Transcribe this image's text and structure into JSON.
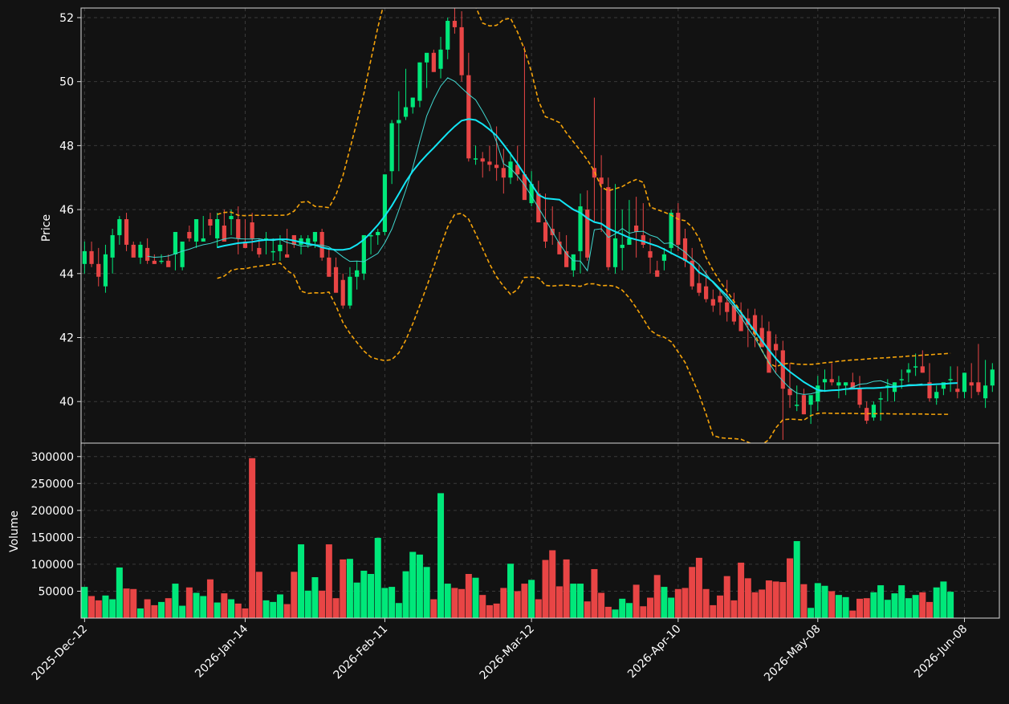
{
  "chart_data": {
    "type": "candlestick",
    "dates": [
      "2025-12-12",
      "2025-12-15",
      "2025-12-16",
      "2025-12-17",
      "2025-12-18",
      "2025-12-19",
      "2025-12-22",
      "2025-12-23",
      "2025-12-24",
      "2025-12-25",
      "2025-12-26",
      "2025-12-29",
      "2025-12-30",
      "2025-12-31",
      "2026-01-01",
      "2026-01-02",
      "2026-01-05",
      "2026-01-06",
      "2026-01-07",
      "2026-01-08",
      "2026-01-09",
      "2026-01-12",
      "2026-01-13",
      "2026-01-14",
      "2026-01-15",
      "2026-01-16",
      "2026-01-19",
      "2026-01-20",
      "2026-01-21",
      "2026-01-22",
      "2026-01-23",
      "2026-01-26",
      "2026-01-27",
      "2026-01-28",
      "2026-01-29",
      "2026-01-30",
      "2026-02-02",
      "2026-02-03",
      "2026-02-04",
      "2026-02-05",
      "2026-02-06",
      "2026-02-09",
      "2026-02-10",
      "2026-02-11",
      "2026-02-12",
      "2026-02-13",
      "2026-02-16",
      "2026-02-17",
      "2026-02-18",
      "2026-02-19",
      "2026-02-20",
      "2026-02-23",
      "2026-02-24",
      "2026-02-25",
      "2026-02-26",
      "2026-02-27",
      "2026-03-02",
      "2026-03-03",
      "2026-03-04",
      "2026-03-05",
      "2026-03-06",
      "2026-03-09",
      "2026-03-10",
      "2026-03-11",
      "2026-03-12",
      "2026-03-13",
      "2026-03-16",
      "2026-03-17",
      "2026-03-18",
      "2026-03-19",
      "2026-03-20",
      "2026-03-23",
      "2026-03-24",
      "2026-03-25",
      "2026-03-26",
      "2026-03-27",
      "2026-03-30",
      "2026-03-31",
      "2026-04-01",
      "2026-04-02",
      "2026-04-03",
      "2026-04-06",
      "2026-04-07",
      "2026-04-08",
      "2026-04-09",
      "2026-04-10",
      "2026-04-13",
      "2026-04-14",
      "2026-04-15",
      "2026-04-16",
      "2026-04-17",
      "2026-04-20",
      "2026-04-21",
      "2026-04-22",
      "2026-04-23",
      "2026-04-24",
      "2026-04-27",
      "2026-04-28",
      "2026-04-29",
      "2026-04-30",
      "2026-05-01",
      "2026-05-04",
      "2026-05-05",
      "2026-05-06",
      "2026-05-07",
      "2026-05-08",
      "2026-05-11",
      "2026-05-12",
      "2026-05-13",
      "2026-05-14",
      "2026-05-15",
      "2026-05-18",
      "2026-05-19",
      "2026-05-20",
      "2026-05-21",
      "2026-05-22",
      "2026-05-25",
      "2026-05-26",
      "2026-05-27",
      "2026-05-28",
      "2026-05-29",
      "2026-06-01",
      "2026-06-02",
      "2026-06-03",
      "2026-06-04",
      "2026-06-05",
      "2026-06-08",
      "2026-06-09",
      "2026-06-10",
      "2026-06-11",
      "2026-06-12"
    ],
    "open": [
      44.3,
      44.7,
      44.3,
      43.6,
      44.5,
      45.2,
      45.7,
      44.9,
      44.5,
      44.8,
      44.4,
      44.4,
      44.4,
      44.6,
      44.2,
      45.3,
      45.0,
      45.0,
      45.7,
      45.1,
      45.5,
      45.7,
      45.7,
      45.0,
      45.6,
      44.8,
      45.1,
      44.7,
      44.7,
      44.6,
      45.2,
      44.9,
      44.9,
      45.0,
      45.3,
      44.5,
      44.2,
      43.8,
      43.0,
      43.9,
      44.0,
      45.2,
      45.2,
      45.3,
      47.2,
      48.7,
      48.9,
      49.2,
      49.4,
      50.6,
      50.9,
      50.4,
      51.0,
      51.9,
      51.7,
      50.2,
      47.6,
      47.6,
      47.5,
      47.4,
      47.3,
      47.0,
      47.4,
      47.1,
      46.2,
      46.5,
      45.6,
      45.4,
      45.0,
      44.7,
      44.1,
      44.7,
      46.0,
      47.3,
      47.0,
      46.7,
      44.2,
      44.8,
      44.9,
      45.5,
      45.2,
      44.7,
      44.1,
      44.4,
      44.8,
      45.9,
      45.1,
      44.4,
      43.7,
      43.6,
      43.2,
      43.3,
      43.1,
      43.0,
      42.7,
      42.6,
      42.7,
      42.3,
      42.2,
      41.8,
      41.6,
      40.4,
      39.9,
      40.2,
      39.9,
      40.0,
      40.6,
      40.7,
      40.5,
      40.5,
      40.6,
      40.4,
      39.8,
      39.5,
      40.1,
      40.5,
      40.3,
      40.7,
      40.9,
      41.1,
      41.1,
      40.6,
      40.1,
      40.4,
      40.7,
      40.4,
      40.3,
      40.6,
      40.6,
      40.1,
      40.5
    ],
    "high": [
      45.0,
      45.0,
      44.8,
      44.9,
      45.4,
      45.8,
      45.9,
      45.0,
      45.0,
      45.1,
      44.6,
      44.6,
      44.6,
      44.9,
      44.9,
      45.5,
      45.7,
      45.8,
      45.9,
      45.9,
      46.0,
      46.0,
      46.1,
      45.7,
      45.9,
      45.1,
      45.3,
      45.1,
      45.2,
      45.4,
      45.2,
      45.2,
      45.2,
      45.3,
      45.4,
      44.8,
      44.5,
      44.0,
      44.2,
      44.4,
      44.7,
      45.3,
      45.4,
      45.6,
      48.8,
      49.7,
      50.4,
      49.5,
      50.6,
      50.7,
      51.0,
      51.4,
      52.0,
      52.3,
      52.2,
      50.9,
      48.0,
      47.8,
      48.0,
      48.6,
      47.9,
      47.8,
      48.0,
      51.1,
      47.2,
      46.9,
      46.5,
      46.1,
      45.3,
      45.2,
      44.6,
      46.5,
      46.6,
      49.5,
      47.7,
      47.0,
      46.8,
      46.0,
      46.3,
      46.4,
      46.2,
      45.1,
      44.4,
      44.8,
      46.0,
      46.2,
      45.4,
      44.8,
      44.3,
      44.1,
      43.5,
      43.5,
      43.8,
      43.4,
      43.1,
      42.9,
      42.9,
      42.7,
      42.5,
      42.1,
      41.9,
      41.2,
      40.5,
      40.4,
      40.0,
      40.8,
      41.0,
      41.2,
      40.8,
      40.6,
      40.9,
      40.8,
      40.0,
      40.0,
      40.3,
      40.7,
      40.6,
      41.0,
      41.2,
      41.5,
      41.6,
      41.2,
      40.5,
      40.5,
      41.1,
      41.1,
      40.9,
      41.2,
      41.8,
      41.3,
      41.2
    ],
    "low": [
      44.0,
      44.2,
      43.6,
      43.4,
      44.0,
      44.9,
      44.7,
      44.6,
      44.3,
      44.3,
      44.3,
      44.3,
      44.3,
      44.1,
      44.1,
      45.0,
      44.8,
      45.0,
      45.2,
      44.8,
      45.3,
      45.2,
      44.6,
      44.8,
      44.7,
      44.5,
      44.6,
      44.4,
      44.4,
      44.5,
      44.8,
      44.6,
      44.8,
      44.8,
      44.4,
      43.9,
      43.4,
      42.9,
      42.9,
      43.5,
      43.8,
      44.6,
      44.9,
      45.2,
      46.8,
      47.2,
      48.8,
      49.0,
      49.2,
      49.8,
      50.3,
      50.1,
      50.7,
      51.5,
      50.0,
      47.5,
      47.4,
      47.0,
      47.2,
      46.9,
      46.5,
      46.8,
      46.9,
      46.9,
      46.1,
      45.9,
      44.8,
      44.9,
      44.9,
      44.6,
      43.9,
      44.0,
      44.4,
      45.6,
      45.3,
      44.1,
      44.0,
      44.1,
      44.9,
      44.5,
      44.8,
      44.0,
      43.9,
      44.1,
      44.6,
      44.7,
      44.2,
      43.5,
      43.3,
      43.1,
      42.8,
      42.7,
      42.5,
      42.4,
      42.2,
      41.7,
      41.7,
      41.8,
      41.6,
      40.9,
      38.8,
      39.8,
      39.7,
      39.6,
      39.3,
      39.7,
      40.3,
      40.5,
      40.1,
      40.2,
      40.4,
      39.8,
      39.3,
      39.4,
      39.4,
      40.0,
      40.0,
      40.4,
      40.6,
      40.8,
      40.9,
      40.0,
      39.9,
      40.2,
      40.3,
      40.1,
      40.1,
      40.1,
      40.2,
      39.8,
      40.3
    ],
    "close": [
      44.7,
      44.3,
      43.9,
      44.6,
      45.2,
      45.7,
      44.9,
      44.5,
      44.9,
      44.4,
      44.3,
      44.4,
      44.2,
      45.3,
      45.0,
      45.1,
      45.7,
      45.1,
      45.5,
      45.7,
      45.0,
      45.8,
      45.1,
      44.8,
      45.1,
      44.6,
      45.1,
      44.7,
      44.9,
      44.5,
      44.9,
      45.1,
      45.1,
      45.3,
      44.5,
      43.9,
      43.4,
      43.0,
      43.9,
      44.1,
      45.2,
      45.2,
      45.3,
      47.1,
      48.7,
      48.8,
      49.2,
      49.5,
      50.6,
      50.9,
      50.3,
      51.0,
      51.9,
      51.7,
      50.2,
      47.6,
      47.6,
      47.5,
      47.4,
      47.3,
      47.0,
      47.5,
      47.1,
      46.3,
      46.8,
      45.6,
      45.0,
      45.2,
      44.6,
      44.2,
      44.6,
      46.1,
      44.5,
      47.0,
      46.8,
      44.2,
      45.1,
      44.9,
      45.1,
      45.3,
      44.9,
      44.5,
      43.9,
      44.6,
      45.9,
      44.9,
      44.4,
      43.6,
      43.4,
      43.2,
      43.0,
      43.1,
      42.8,
      42.5,
      42.2,
      42.4,
      42.1,
      41.7,
      40.9,
      41.6,
      40.4,
      40.2,
      39.9,
      39.6,
      40.2,
      40.5,
      40.7,
      40.6,
      40.6,
      40.6,
      40.4,
      39.9,
      39.4,
      39.9,
      40.1,
      40.5,
      40.6,
      40.7,
      41.0,
      41.1,
      40.9,
      40.1,
      40.3,
      40.6,
      40.7,
      40.3,
      40.9,
      40.5,
      40.3,
      40.5,
      41.0
    ],
    "volume": [
      58000,
      41000,
      33000,
      42000,
      35000,
      94000,
      55000,
      54000,
      18000,
      35000,
      24000,
      30000,
      37000,
      64000,
      23000,
      57000,
      47000,
      41000,
      72000,
      29000,
      46000,
      35000,
      27000,
      18000,
      297000,
      86000,
      33000,
      30000,
      44000,
      26000,
      86000,
      137000,
      51000,
      76000,
      51000,
      137000,
      37000,
      109000,
      110000,
      66000,
      88000,
      82000,
      149000,
      56000,
      58000,
      28000,
      87000,
      123000,
      118000,
      95000,
      35000,
      232000,
      64000,
      56000,
      54000,
      82000,
      75000,
      43000,
      24000,
      27000,
      56000,
      101000,
      50000,
      64000,
      71000,
      35000,
      108000,
      126000,
      59000,
      109000,
      64000,
      64000,
      31000,
      91000,
      47000,
      21000,
      16000,
      36000,
      28000,
      62000,
      22000,
      38000,
      80000,
      58000,
      38000,
      54000,
      56000,
      95000,
      112000,
      54000,
      24000,
      42000,
      78000,
      33000,
      103000,
      74000,
      48000,
      53000,
      70000,
      68000,
      67000,
      111000,
      143000,
      63000,
      19000,
      65000,
      60000,
      50000,
      43000,
      39000,
      14000,
      36000,
      37000,
      48000,
      61000,
      34000,
      46000,
      61000,
      37000,
      43000,
      48000,
      30000,
      57000,
      68000,
      49000
    ],
    "ma_fast": [
      null,
      null,
      null,
      null,
      null,
      null,
      null,
      null,
      null,
      44.54,
      44.51,
      44.52,
      44.55,
      44.62,
      44.7,
      44.76,
      44.84,
      44.9,
      44.94,
      45.01,
      45.08,
      45.12,
      45.09,
      45.08,
      45.08,
      45.09,
      45.05,
      45.03,
      45.07,
      44.97,
      44.92,
      44.86,
      44.86,
      44.9,
      44.89,
      44.83,
      44.69,
      44.52,
      44.38,
      44.39,
      44.37,
      44.5,
      44.63,
      44.96,
      45.39,
      45.98,
      46.61,
      47.31,
      48.14,
      48.93,
      49.44,
      49.86,
      50.12,
      50.01,
      49.8,
      49.6,
      49.43,
      49.07,
      48.67,
      48.11,
      47.43,
      47.29,
      47.05,
      46.77,
      46.42,
      46.06,
      45.69,
      45.31,
      44.94,
      44.62,
      44.4,
      44.39,
      44.09,
      45.37,
      45.4,
      45.13,
      45.24,
      45.41,
      45.26,
      45.31,
      45.32,
      45.2,
      45.13,
      44.94,
      44.96,
      44.82,
      44.67,
      44.46,
      44.28,
      43.99,
      43.71,
      43.47,
      43.21,
      42.95,
      42.65,
      42.29,
      41.99,
      41.59,
      41.22,
      40.88,
      40.64,
      40.42,
      40.26,
      40.22,
      40.24,
      40.3,
      40.33,
      40.35,
      40.36,
      40.38,
      40.45,
      40.54,
      40.56,
      40.63,
      40.65,
      40.57,
      40.48,
      40.47,
      40.53,
      40.53,
      40.55
    ],
    "ma_slow": [
      null,
      null,
      null,
      null,
      null,
      null,
      null,
      null,
      null,
      null,
      null,
      null,
      null,
      null,
      null,
      null,
      null,
      null,
      null,
      44.82,
      44.87,
      44.91,
      44.95,
      44.97,
      44.99,
      45.03,
      45.05,
      45.06,
      45.07,
      45.07,
      45.03,
      44.98,
      44.93,
      44.89,
      44.82,
      44.77,
      44.74,
      44.74,
      44.78,
      44.9,
      45.06,
      45.28,
      45.52,
      45.8,
      46.12,
      46.49,
      46.87,
      47.2,
      47.47,
      47.71,
      47.93,
      48.16,
      48.39,
      48.6,
      48.78,
      48.83,
      48.8,
      48.67,
      48.5,
      48.31,
      48.03,
      47.74,
      47.43,
      47.1,
      46.79,
      46.46,
      46.35,
      46.33,
      46.31,
      46.15,
      46.0,
      45.9,
      45.73,
      45.61,
      45.56,
      45.41,
      45.31,
      45.22,
      45.12,
      45.06,
      45.01,
      44.93,
      44.86,
      44.76,
      44.64,
      44.53,
      44.42,
      44.28,
      44.04,
      43.91,
      43.74,
      43.52,
      43.3,
      43.04,
      42.77,
      42.48,
      42.2,
      41.9,
      41.61,
      41.34,
      41.12,
      40.93,
      40.77,
      40.61,
      40.48,
      40.36,
      40.33,
      40.35,
      40.36,
      40.39,
      40.4,
      40.41,
      40.42,
      40.42,
      40.43,
      40.45,
      40.46,
      40.48,
      40.5,
      40.51,
      40.52,
      40.53,
      40.54,
      40.55,
      40.57,
      40.58
    ],
    "bb_upper": [
      null,
      null,
      null,
      null,
      null,
      null,
      null,
      null,
      null,
      null,
      null,
      null,
      null,
      null,
      null,
      null,
      null,
      null,
      null,
      45.85,
      45.91,
      45.92,
      45.82,
      45.81,
      45.82,
      45.82,
      45.82,
      45.82,
      45.82,
      45.83,
      45.95,
      46.23,
      46.25,
      46.1,
      46.09,
      46.06,
      46.46,
      47.06,
      47.9,
      48.74,
      49.63,
      50.68,
      51.7,
      52.55,
      53.4,
      54.1,
      54.5,
      54.7,
      54.75,
      54.7,
      54.4,
      54.04,
      53.65,
      53.24,
      52.97,
      52.78,
      52.35,
      51.83,
      51.74,
      51.76,
      51.94,
      51.98,
      51.55,
      51.0,
      50.3,
      49.4,
      48.9,
      48.82,
      48.72,
      48.4,
      48.12,
      47.84,
      47.55,
      47.2,
      46.7,
      46.59,
      46.65,
      46.72,
      46.85,
      46.94,
      46.85,
      46.08,
      46.0,
      45.92,
      45.83,
      45.7,
      45.65,
      45.45,
      45.1,
      44.5,
      44.1,
      43.75,
      43.45,
      43.13,
      42.8,
      42.48,
      42.1,
      41.6,
      41.2,
      41.09,
      41.17,
      41.2,
      41.17,
      41.16,
      41.16,
      41.18,
      41.21,
      41.23,
      41.26,
      41.28,
      41.3,
      41.31,
      41.33,
      41.35,
      41.36,
      41.37,
      41.39,
      41.4,
      41.42,
      41.43,
      41.45,
      41.46,
      41.48,
      41.49,
      41.51
    ],
    "bb_lower": [
      null,
      null,
      null,
      null,
      null,
      null,
      null,
      null,
      null,
      null,
      null,
      null,
      null,
      null,
      null,
      null,
      null,
      null,
      null,
      43.85,
      43.92,
      44.1,
      44.15,
      44.15,
      44.2,
      44.23,
      44.26,
      44.29,
      44.33,
      44.1,
      43.95,
      43.45,
      43.38,
      43.4,
      43.39,
      43.42,
      42.99,
      42.47,
      42.13,
      41.85,
      41.58,
      41.39,
      41.32,
      41.28,
      41.31,
      41.52,
      41.92,
      42.43,
      43.0,
      43.6,
      44.21,
      44.85,
      45.46,
      45.85,
      45.88,
      45.7,
      45.25,
      44.78,
      44.3,
      43.9,
      43.6,
      43.35,
      43.5,
      43.88,
      43.89,
      43.87,
      43.63,
      43.61,
      43.63,
      43.64,
      43.62,
      43.6,
      43.68,
      43.68,
      43.62,
      43.63,
      43.6,
      43.48,
      43.24,
      42.93,
      42.59,
      42.23,
      42.08,
      42.01,
      41.87,
      41.55,
      41.22,
      40.73,
      40.22,
      39.61,
      38.94,
      38.87,
      38.85,
      38.84,
      38.82,
      38.73,
      38.63,
      38.65,
      38.81,
      39.18,
      39.43,
      39.45,
      39.44,
      39.42,
      39.56,
      39.63,
      39.64,
      39.63,
      39.63,
      39.63,
      39.63,
      39.62,
      39.62,
      39.62,
      39.62,
      39.62,
      39.61,
      39.61,
      39.61,
      39.61,
      39.61,
      39.6,
      39.6,
      39.6,
      39.6
    ],
    "price_ylim": [
      38.7,
      52.3
    ],
    "volume_ylim": [
      0,
      325000
    ],
    "price_ticks": [
      40,
      42,
      44,
      46,
      48,
      50,
      52
    ],
    "volume_ticks": [
      50000,
      100000,
      150000,
      200000,
      250000,
      300000
    ],
    "ylabel_price": "Price",
    "ylabel_volume": "Volume",
    "xtick_labels": [
      "2025-Dec-12",
      "2026-Jan-14",
      "2026-Feb-11",
      "2026-Mar-12",
      "2026-Apr-10",
      "2026-May-08",
      "2026-Jun-08"
    ],
    "grid": true,
    "colors": {
      "background": "#121212",
      "up": "#00e87a",
      "down": "#e84545",
      "ma_fast": "#40d8d0",
      "ma_slow": "#12e6f5",
      "bollinger": "#f5a30a",
      "grid": "#3a3a3a",
      "axis": "#d8d8d8",
      "text": "#ffffff"
    }
  }
}
